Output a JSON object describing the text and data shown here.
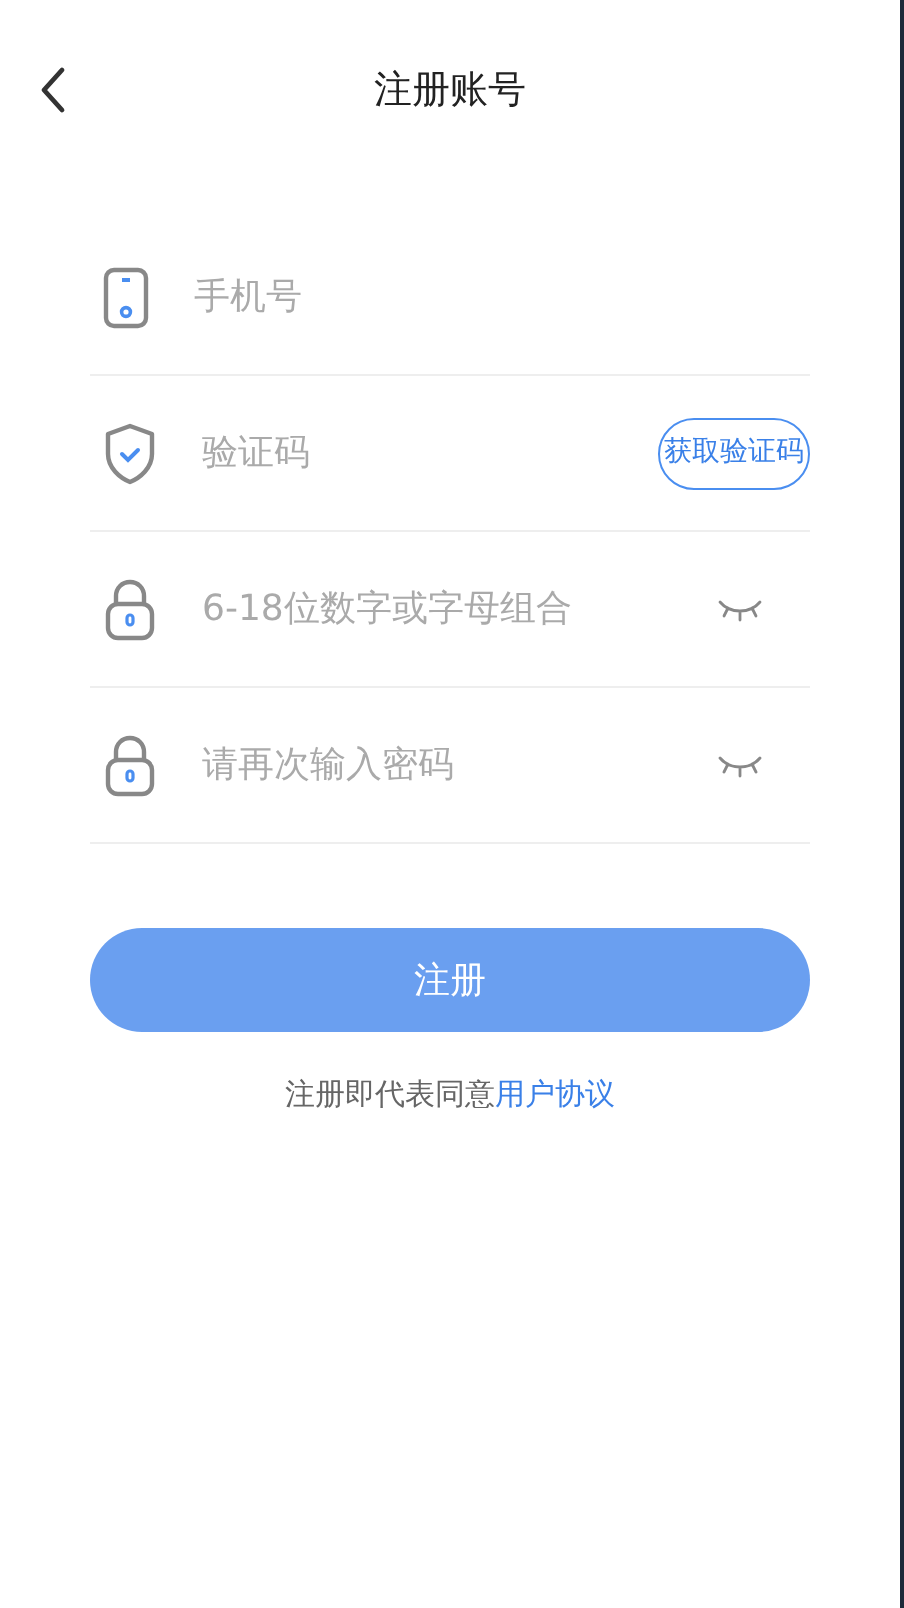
{
  "header": {
    "title": "注册账号"
  },
  "fields": [
    {
      "kind": "phone",
      "placeholder": "手机号"
    },
    {
      "kind": "code",
      "placeholder": "验证码",
      "action": "获取验证码"
    },
    {
      "kind": "password",
      "placeholder": "6-18位数字或字母组合",
      "revealed": false
    },
    {
      "kind": "password",
      "placeholder": "请再次输入密码",
      "revealed": false
    }
  ],
  "submit": {
    "label": "注册",
    "disabled": true
  },
  "agreement": {
    "text": "注册即代表同意",
    "link": "用户协议"
  }
}
